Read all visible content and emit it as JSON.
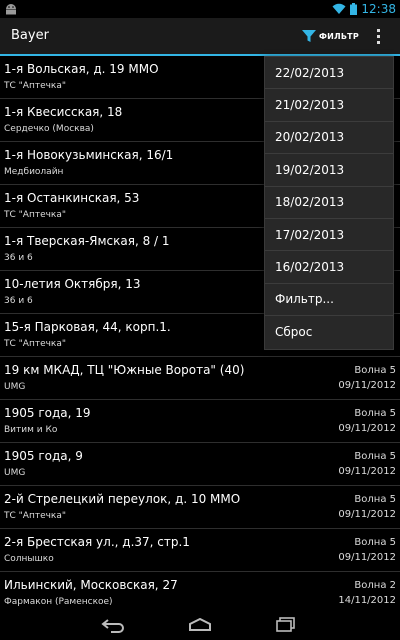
{
  "status_bar": {
    "time": "12:38"
  },
  "action_bar": {
    "title": "Bayer",
    "filter_label": "ФИЛЬТР"
  },
  "list": [
    {
      "address": "1-я Вольская, д. 19     ММО",
      "store": "ТС \"Аптечка\"",
      "wave": "",
      "date": ""
    },
    {
      "address": "1-я Квесисская, 18",
      "store": "Сердечко (Москва)",
      "wave": "",
      "date": ""
    },
    {
      "address": "1-я Новокузьминская, 16/1",
      "store": "Медбиолайн",
      "wave": "",
      "date": ""
    },
    {
      "address": "1-я Останкинская, 53",
      "store": "ТС \"Аптечка\"",
      "wave": "",
      "date": ""
    },
    {
      "address": "1-я Тверская-Ямская, 8 / 1",
      "store": "36 и 6",
      "wave": "",
      "date": ""
    },
    {
      "address": "10-летия Октября, 13",
      "store": "36 и 6",
      "wave": "",
      "date": ""
    },
    {
      "address": "15-я Парковая, 44, корп.1.",
      "store": "ТС \"Аптечка\"",
      "wave": "",
      "date": ""
    },
    {
      "address": "19 км МКАД, ТЦ \"Южные Ворота\" (40)",
      "store": "UMG",
      "wave": "Волна 5",
      "date": "09/11/2012"
    },
    {
      "address": "1905 года, 19",
      "store": "Витим и Ко",
      "wave": "Волна 5",
      "date": "09/11/2012"
    },
    {
      "address": "1905 года, 9",
      "store": "UMG",
      "wave": "Волна 5",
      "date": "09/11/2012"
    },
    {
      "address": "2-й Стрелецкий переулок, д. 10     ММО",
      "store": "ТС \"Аптечка\"",
      "wave": "Волна 5",
      "date": "09/11/2012"
    },
    {
      "address": "2-я Брестская ул., д.37, стр.1",
      "store": "Солнышко",
      "wave": "Волна 5",
      "date": "09/11/2012"
    },
    {
      "address": "Ильинский, Московская, 27",
      "store": "Фармакон (Раменское)",
      "wave": "Волна 2",
      "date": "14/11/2012"
    }
  ],
  "menu": [
    "22/02/2013",
    "21/02/2013",
    "20/02/2013",
    "19/02/2013",
    "18/02/2013",
    "17/02/2013",
    "16/02/2013",
    "Фильтр...",
    "Сброс"
  ],
  "colors": {
    "accent": "#33b5e5",
    "background": "#000000",
    "menu_bg": "#282828"
  },
  "icons": [
    "android-icon",
    "wifi-icon",
    "battery-icon",
    "filter-icon",
    "overflow-icon",
    "back-icon",
    "home-icon",
    "recents-icon"
  ]
}
